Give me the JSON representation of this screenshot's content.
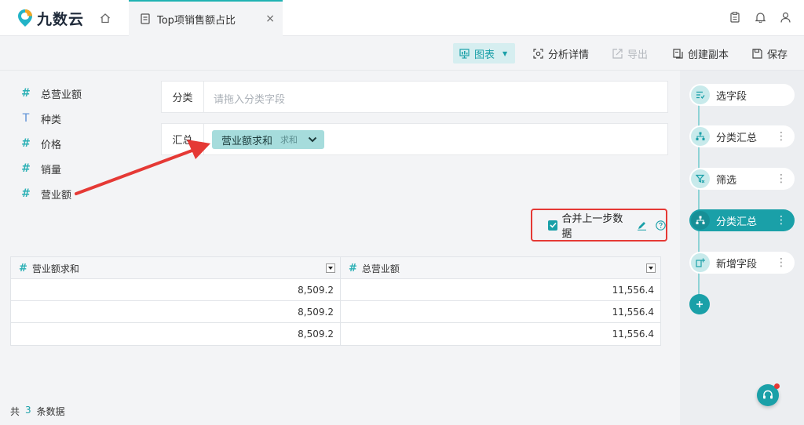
{
  "app": {
    "logo_text": "九数云"
  },
  "tab": {
    "label": "Top项销售额占比",
    "close": "×"
  },
  "toolbar": {
    "chart": "图表",
    "analysis": "分析详情",
    "export": "导出",
    "copy": "创建副本",
    "save": "保存"
  },
  "fields": [
    {
      "type": "#",
      "label": "总营业额"
    },
    {
      "type": "T",
      "label": "种类"
    },
    {
      "type": "#",
      "label": "价格"
    },
    {
      "type": "#",
      "label": "销量"
    },
    {
      "type": "#",
      "label": "营业额"
    }
  ],
  "config": {
    "category_label": "分类",
    "category_placeholder": "请拖入分类字段",
    "summary_label": "汇总",
    "chip_name": "营业额求和",
    "chip_agg": "求和"
  },
  "merge": {
    "label": "合并上一步数据",
    "checked": true
  },
  "table": {
    "headers": [
      "营业额求和",
      "总营业额"
    ],
    "rows": [
      [
        "8,509.2",
        "11,556.4"
      ],
      [
        "8,509.2",
        "11,556.4"
      ],
      [
        "8,509.2",
        "11,556.4"
      ]
    ]
  },
  "footer": {
    "prefix": "共",
    "count": "3",
    "suffix": "条数据"
  },
  "steps": [
    {
      "label": "选字段",
      "active": false,
      "more": false
    },
    {
      "label": "分类汇总",
      "active": false,
      "more": true
    },
    {
      "label": "筛选",
      "active": false,
      "more": true
    },
    {
      "label": "分类汇总",
      "active": true,
      "more": true
    },
    {
      "label": "新增字段",
      "active": false,
      "more": true
    }
  ],
  "colors": {
    "accent": "#1aa0a8",
    "highlight": "#e53935"
  }
}
